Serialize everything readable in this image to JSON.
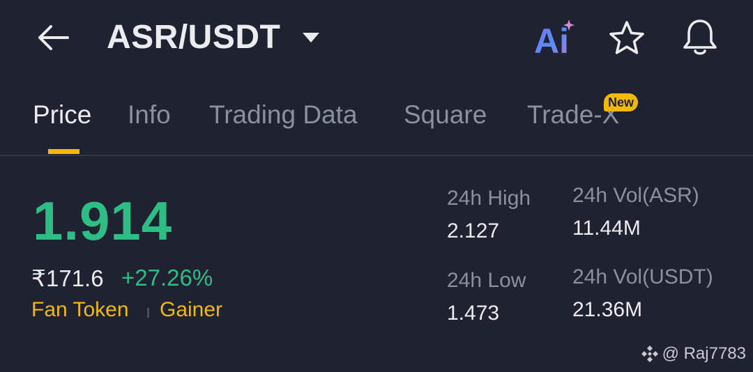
{
  "header": {
    "pair": "ASR/USDT",
    "icons": {
      "back": "arrow-left-icon",
      "dropdown": "caret-down-icon",
      "ai": "ai-icon",
      "favorite": "star-icon",
      "alerts": "bell-icon"
    },
    "ai_label": "Ai"
  },
  "tabs": [
    {
      "label": "Price",
      "active": true
    },
    {
      "label": "Info",
      "active": false
    },
    {
      "label": "Trading Data",
      "active": false
    },
    {
      "label": "Square",
      "active": false
    },
    {
      "label": "Trade-X",
      "active": false,
      "badge": "New"
    }
  ],
  "price": {
    "last": "1.914",
    "fiat": "₹171.6",
    "change": "+27.26%",
    "tags": [
      "Fan Token",
      "Gainer"
    ]
  },
  "stats": {
    "high_label": "24h High",
    "high_value": "2.127",
    "low_label": "24h Low",
    "low_value": "1.473",
    "vol_base_label": "24h Vol(ASR)",
    "vol_base_value": "11.44M",
    "vol_quote_label": "24h Vol(USDT)",
    "vol_quote_value": "21.36M"
  },
  "watermark": "@ Raj7783",
  "colors": {
    "background": "#1f2230",
    "accent": "#f0b90b",
    "up": "#2ebd85",
    "muted": "#8a909f",
    "text": "#eaecef"
  }
}
